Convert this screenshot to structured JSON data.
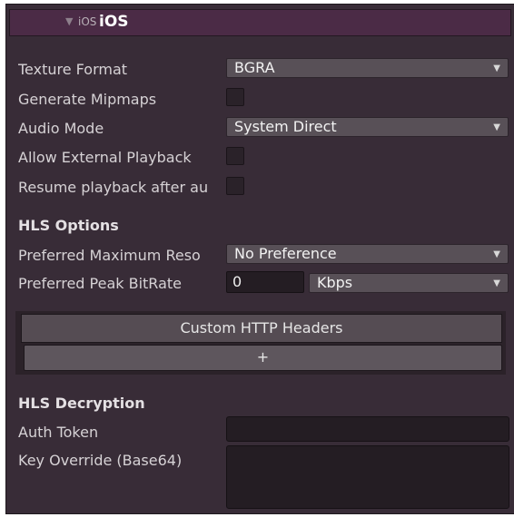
{
  "header": {
    "platform_small": "iOS",
    "platform_title": "iOS"
  },
  "fields": {
    "texture_format": {
      "label": "Texture Format",
      "value": "BGRA"
    },
    "generate_mipmaps": {
      "label": "Generate Mipmaps",
      "checked": false
    },
    "audio_mode": {
      "label": "Audio Mode",
      "value": "System Direct"
    },
    "allow_external_playback": {
      "label": "Allow External Playback",
      "checked": false
    },
    "resume_playback": {
      "label": "Resume playback after au",
      "checked": false
    }
  },
  "hls_options": {
    "title": "HLS Options",
    "preferred_max_reso": {
      "label": "Preferred Maximum Reso",
      "value": "No Preference"
    },
    "preferred_peak_bitrate": {
      "label": "Preferred Peak BitRate",
      "value": "0",
      "unit": "Kbps"
    }
  },
  "custom_headers": {
    "title": "Custom HTTP Headers",
    "add_label": "+"
  },
  "hls_decryption": {
    "title": "HLS Decryption",
    "auth_token": {
      "label": "Auth Token",
      "value": ""
    },
    "key_override": {
      "label": "Key Override (Base64)",
      "value": ""
    }
  },
  "colors": {
    "panel_bg": "#382c37",
    "header_bg": "#4b2b46",
    "dropdown_bg": "#585057",
    "field_bg": "#241d23"
  }
}
